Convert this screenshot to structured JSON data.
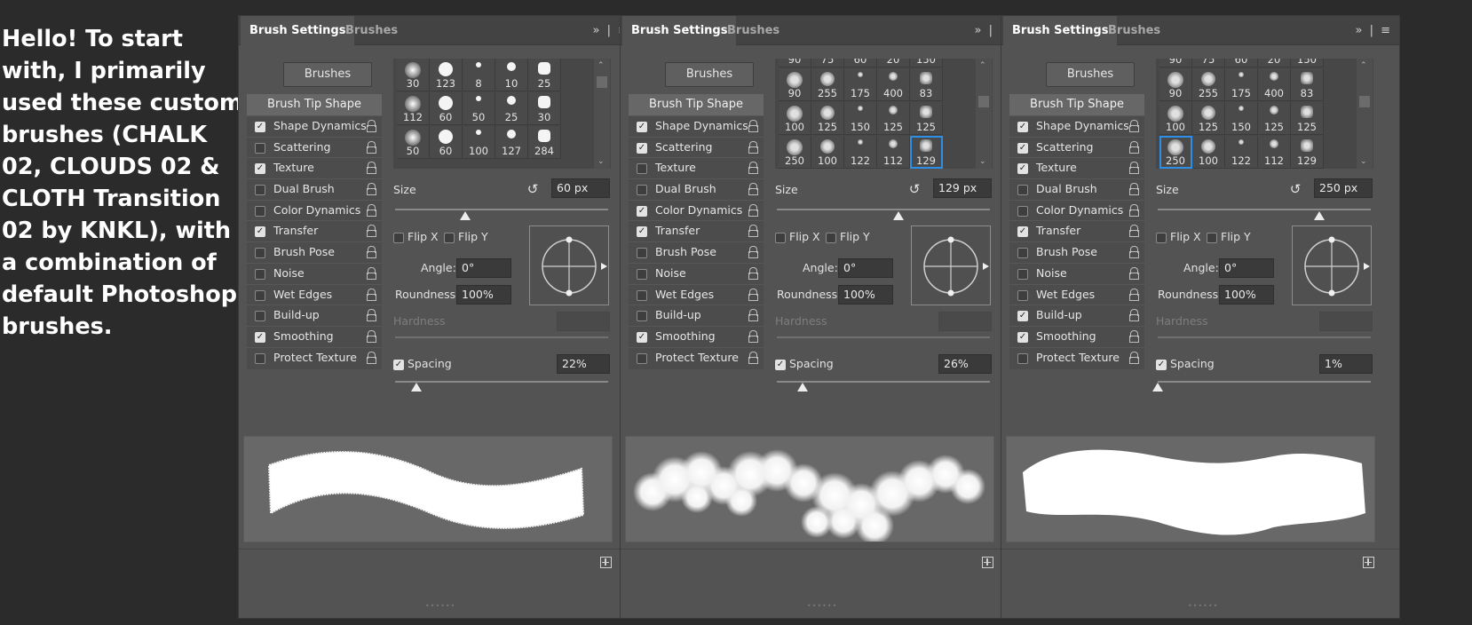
{
  "intro_text": "Hello! To start with, I primarily used these custom brushes (CHALK 02, CLOUDS 02 & CLOTH Transition 02 by KNKL), with a combination of default Photoshop brushes.",
  "labels": {
    "tab_brush_settings": "Brush Settings",
    "tab_brushes": "Brushes",
    "brushes_button": "Brushes",
    "brush_tip_shape": "Brush Tip Shape",
    "size": "Size",
    "flip_x": "Flip X",
    "flip_y": "Flip Y",
    "angle": "Angle:",
    "roundness": "Roundness:",
    "hardness": "Hardness",
    "spacing": "Spacing"
  },
  "icons": {
    "expand": "double-chevron-icon",
    "menu": "hamburger-menu-icon",
    "lock": "lock-icon",
    "reset": "reset-icon",
    "new": "new-brush-icon"
  },
  "panels": [
    {
      "options": [
        {
          "label": "Shape Dynamics",
          "checked": true
        },
        {
          "label": "Scattering",
          "checked": false
        },
        {
          "label": "Texture",
          "checked": true
        },
        {
          "label": "Dual Brush",
          "checked": false
        },
        {
          "label": "Color Dynamics",
          "checked": false
        },
        {
          "label": "Transfer",
          "checked": true
        },
        {
          "label": "Brush Pose",
          "checked": false
        },
        {
          "label": "Noise",
          "checked": false
        },
        {
          "label": "Wet Edges",
          "checked": false
        },
        {
          "label": "Build-up",
          "checked": false
        },
        {
          "label": "Smoothing",
          "checked": true
        },
        {
          "label": "Protect Texture",
          "checked": false
        }
      ],
      "brush_rows": [
        [
          "30",
          "123",
          "8",
          "10",
          "25"
        ],
        [
          "112",
          "60",
          "50",
          "25",
          "30"
        ],
        [
          "50",
          "60",
          "100",
          "127",
          "284"
        ]
      ],
      "selected_index": -1,
      "size": "60 px",
      "size_level": 0.33,
      "flip_x": false,
      "flip_y": false,
      "angle": "0°",
      "roundness": "100%",
      "spacing_enabled": true,
      "spacing": "22%",
      "spacing_level": 0.1,
      "preview": "chalk"
    },
    {
      "options": [
        {
          "label": "Shape Dynamics",
          "checked": true
        },
        {
          "label": "Scattering",
          "checked": true
        },
        {
          "label": "Texture",
          "checked": false
        },
        {
          "label": "Dual Brush",
          "checked": false
        },
        {
          "label": "Color Dynamics",
          "checked": true
        },
        {
          "label": "Transfer",
          "checked": true
        },
        {
          "label": "Brush Pose",
          "checked": false
        },
        {
          "label": "Noise",
          "checked": false
        },
        {
          "label": "Wet Edges",
          "checked": false
        },
        {
          "label": "Build-up",
          "checked": false
        },
        {
          "label": "Smoothing",
          "checked": true
        },
        {
          "label": "Protect Texture",
          "checked": false
        }
      ],
      "top_partial_row": [
        "90",
        "75",
        "60",
        "20",
        "150"
      ],
      "brush_rows": [
        [
          "90",
          "255",
          "175",
          "400",
          "83"
        ],
        [
          "100",
          "125",
          "150",
          "125",
          "125"
        ],
        [
          "250",
          "100",
          "122",
          "112",
          "129"
        ]
      ],
      "selected_index": 14,
      "size": "129 px",
      "size_level": 0.57,
      "flip_x": false,
      "flip_y": false,
      "angle": "0°",
      "roundness": "100%",
      "spacing_enabled": true,
      "spacing": "26%",
      "spacing_level": 0.12,
      "preview": "clouds"
    },
    {
      "options": [
        {
          "label": "Shape Dynamics",
          "checked": true
        },
        {
          "label": "Scattering",
          "checked": true
        },
        {
          "label": "Texture",
          "checked": true
        },
        {
          "label": "Dual Brush",
          "checked": false
        },
        {
          "label": "Color Dynamics",
          "checked": false
        },
        {
          "label": "Transfer",
          "checked": true
        },
        {
          "label": "Brush Pose",
          "checked": false
        },
        {
          "label": "Noise",
          "checked": false
        },
        {
          "label": "Wet Edges",
          "checked": false
        },
        {
          "label": "Build-up",
          "checked": true
        },
        {
          "label": "Smoothing",
          "checked": true
        },
        {
          "label": "Protect Texture",
          "checked": false
        }
      ],
      "top_partial_row": [
        "90",
        "75",
        "60",
        "20",
        "150"
      ],
      "brush_rows": [
        [
          "90",
          "255",
          "175",
          "400",
          "83"
        ],
        [
          "100",
          "125",
          "150",
          "125",
          "125"
        ],
        [
          "250",
          "100",
          "122",
          "112",
          "129"
        ]
      ],
      "selected_index": 10,
      "size": "250 px",
      "size_level": 0.76,
      "flip_x": false,
      "flip_y": false,
      "angle": "0°",
      "roundness": "100%",
      "spacing_enabled": true,
      "spacing": "1%",
      "spacing_level": 0.0,
      "preview": "cloth"
    }
  ]
}
